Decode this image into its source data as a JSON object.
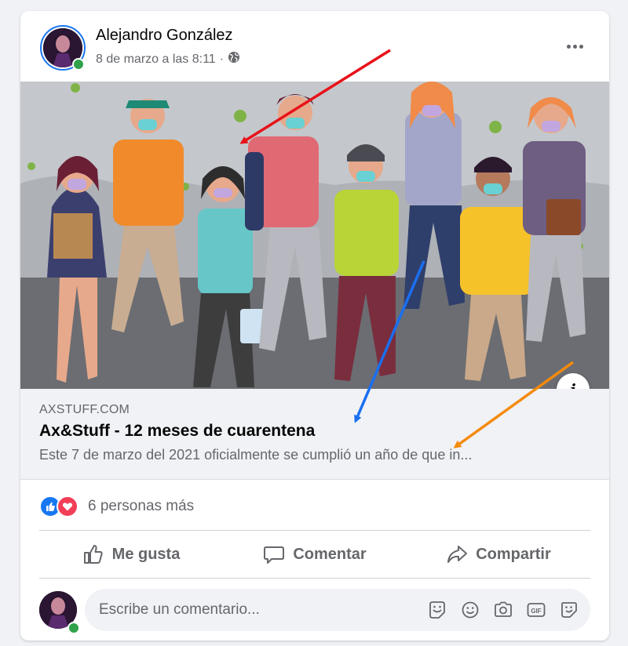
{
  "post": {
    "author": "Alejandro González",
    "timestamp": "8 de marzo a las 8:11",
    "separator": "·",
    "audience_icon": "globe-icon"
  },
  "link": {
    "domain": "AXSTUFF.COM",
    "title": "Ax&Stuff - 12 meses de cuarentena",
    "description": "Este 7 de marzo del 2021 oficialmente se cumplió un año de que in...",
    "info_label": "i"
  },
  "reactions": {
    "icons": [
      "like-icon",
      "love-icon"
    ],
    "summary": "6 personas más"
  },
  "actions": {
    "like": "Me gusta",
    "comment": "Comentar",
    "share": "Compartir"
  },
  "comment": {
    "placeholder": "Escribe un comentario...",
    "icons": [
      "sticker-icon",
      "emoji-icon",
      "camera-icon",
      "gif-icon",
      "avatar-sticker-icon"
    ]
  },
  "annotations": {
    "arrow_colors": [
      "#e8121a",
      "#1a6ff0",
      "#f58a0b"
    ]
  },
  "colors": {
    "brand": "#1877f2",
    "love": "#f33e58",
    "online": "#31a24c"
  }
}
